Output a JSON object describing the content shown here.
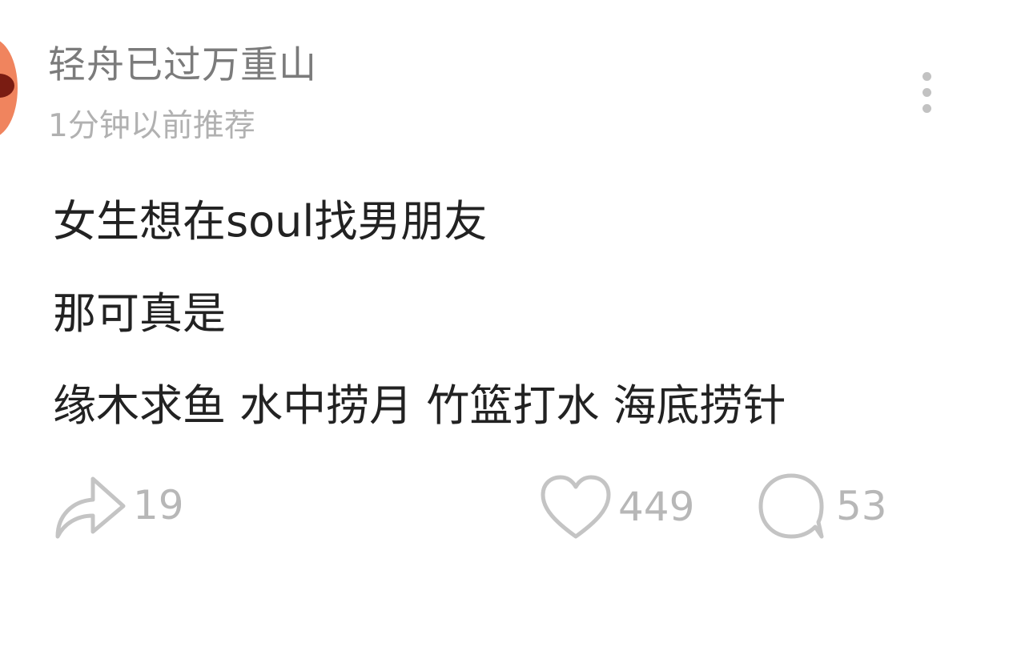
{
  "post": {
    "author": {
      "name": "轻舟已过万重山",
      "avatar_color": "#f0845e"
    },
    "timestamp": "1分钟以前推荐",
    "content_lines": [
      "女生想在soul找男朋友",
      "那可真是",
      "缘木求鱼 水中捞月 竹篮打水 海底捞针"
    ],
    "actions": {
      "share": {
        "icon": "share-arrow-icon",
        "count": "19"
      },
      "like": {
        "icon": "heart-icon",
        "count": "449"
      },
      "comment": {
        "icon": "comment-bubble-icon",
        "count": "53"
      }
    },
    "menu_icon": "more-vertical-icon"
  },
  "colors": {
    "text_primary": "#222222",
    "text_secondary": "#7b7b7b",
    "text_muted": "#b1b1b1",
    "icon_gray": "#c4c4c4"
  }
}
